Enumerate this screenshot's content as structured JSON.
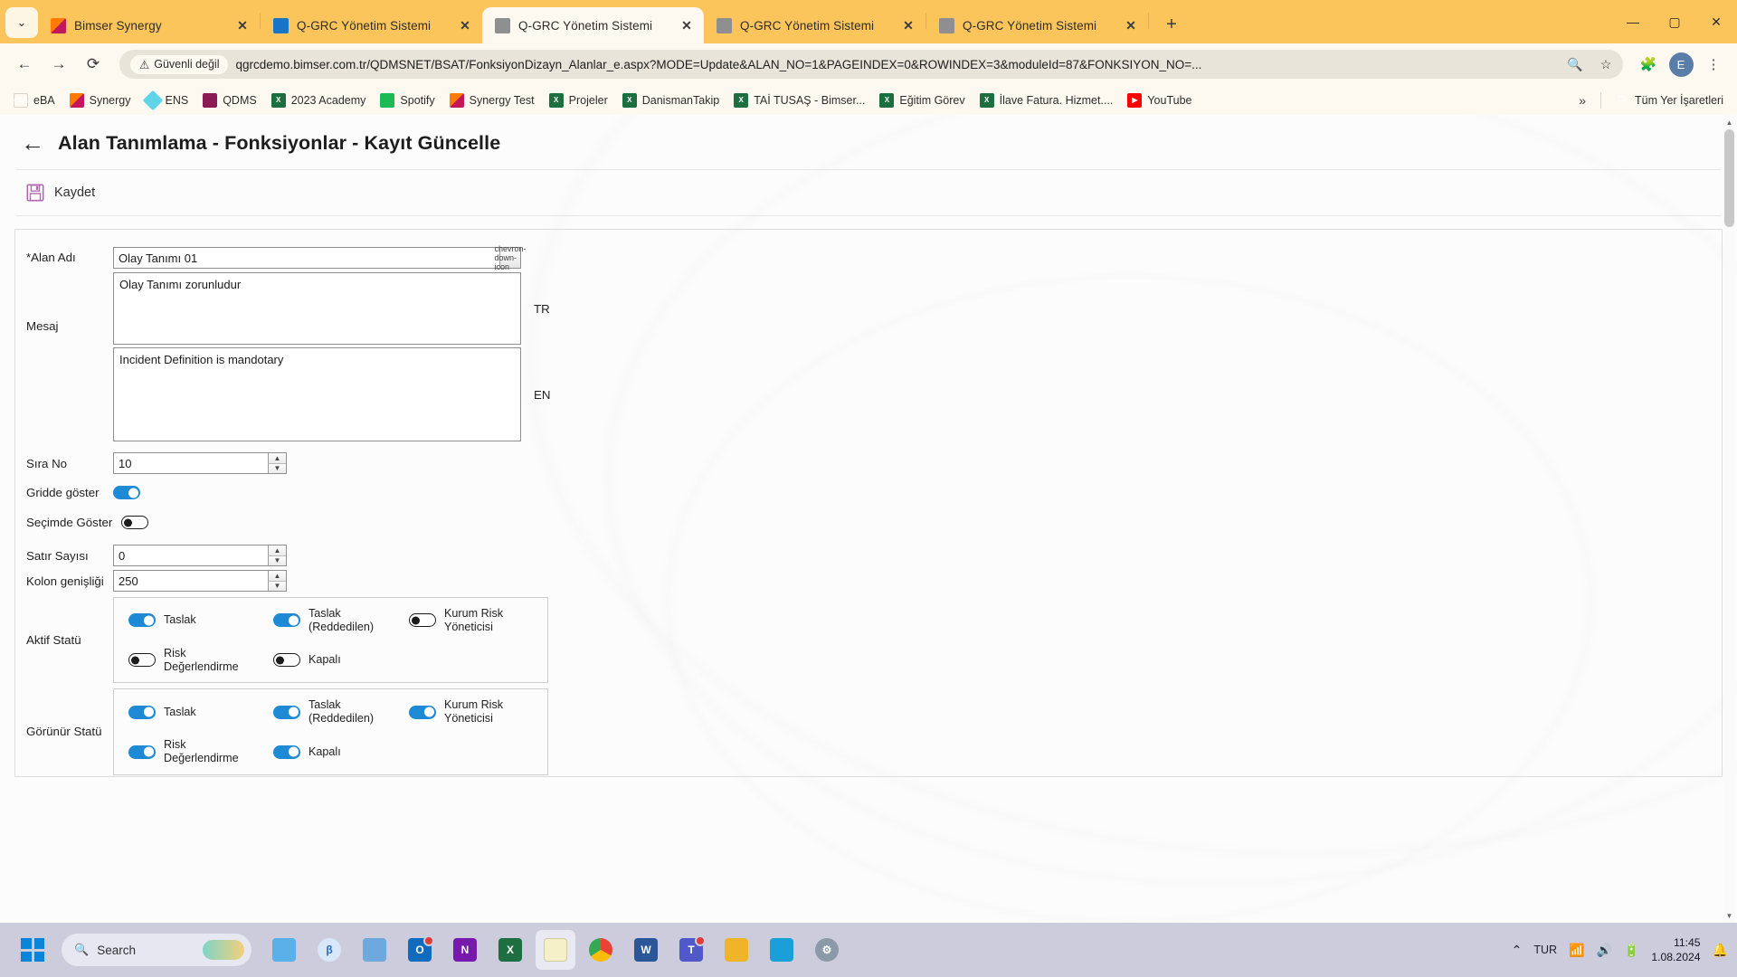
{
  "browser": {
    "tabs": [
      {
        "title": "Bimser Synergy",
        "favicon": "bimser-icon",
        "active": false
      },
      {
        "title": "Q-GRC Yönetim Sistemi",
        "favicon": "qgrc-icon",
        "active": false
      },
      {
        "title": "Q-GRC Yönetim Sistemi",
        "favicon": "globe-icon",
        "active": true
      },
      {
        "title": "Q-GRC Yönetim Sistemi",
        "favicon": "globe-icon",
        "active": false
      },
      {
        "title": "Q-GRC Yönetim Sistemi",
        "favicon": "globe-icon",
        "active": false
      }
    ],
    "tab_close_label": "✕",
    "new_tab_label": "+",
    "window_controls": {
      "minimize": "—",
      "maximize": "▢",
      "close": "✕"
    },
    "nav": {
      "back": "←",
      "forward": "→",
      "reload": "⟳"
    },
    "security_label": "Güvenli değil",
    "security_icon": "warning-triangle-icon",
    "url": "qgrcdemo.bimser.com.tr/QDMSNET/BSAT/FonksiyonDizayn_Alanlar_e.aspx?MODE=Update&ALAN_NO=1&PAGEINDEX=0&ROWINDEX=3&moduleId=87&FONKSIYON_NO=...",
    "zoom_icon": "zoom-search-icon",
    "bookmark_star": "☆",
    "extensions_icon": "extensions-icon",
    "profile_initial": "E",
    "menu_icon": "⋮"
  },
  "bookmarks": {
    "items": [
      {
        "label": "eBA",
        "icon": "eba-icon"
      },
      {
        "label": "Synergy",
        "icon": "synergy-icon"
      },
      {
        "label": "ENS",
        "icon": "ens-icon"
      },
      {
        "label": "QDMS",
        "icon": "qdms-icon"
      },
      {
        "label": "2023 Academy",
        "icon": "excel-icon"
      },
      {
        "label": "Spotify",
        "icon": "spotify-icon"
      },
      {
        "label": "Synergy Test",
        "icon": "synergy-icon"
      },
      {
        "label": "Projeler",
        "icon": "excel-icon"
      },
      {
        "label": "DanismanTakip",
        "icon": "excel-icon"
      },
      {
        "label": "TAİ TUSAŞ - Bimser...",
        "icon": "excel-icon"
      },
      {
        "label": "Eğitim Görev",
        "icon": "excel-icon"
      },
      {
        "label": "İlave Fatura. Hizmet....",
        "icon": "excel-icon"
      },
      {
        "label": "YouTube",
        "icon": "youtube-icon"
      }
    ],
    "overflow_label": "»",
    "all_bookmarks_label": "Tüm Yer İşaretleri",
    "all_bookmarks_icon": "folder-icon"
  },
  "app": {
    "back_arrow": "←",
    "title": "Alan Tanımlama - Fonksiyonlar - Kayıt Güncelle",
    "toolbar": {
      "save_label": "Kaydet",
      "save_icon": "save-floppy-icon"
    },
    "form": {
      "field_name": {
        "label": "*Alan Adı",
        "value": "Olay Tanımı  01",
        "dropdown_icon": "chevron-down-icon"
      },
      "message": {
        "label": "Mesaj",
        "tr_value": "Olay Tanımı zorunludur",
        "tr_tag": "TR",
        "en_value": "Incident Definition is mandotary",
        "en_tag": "EN"
      },
      "order_no": {
        "label": "Sıra No",
        "value": "10"
      },
      "show_in_grid": {
        "label": "Gridde göster",
        "state": "on"
      },
      "show_in_selection": {
        "label": "Seçimde Göster",
        "state": "off"
      },
      "row_count": {
        "label": "Satır Sayısı",
        "value": "0"
      },
      "column_width": {
        "label": "Kolon genişliği",
        "value": "250"
      },
      "active_status": {
        "label": "Aktif Statü",
        "items": [
          {
            "label": "Taslak",
            "state": "on"
          },
          {
            "label": "Taslak (Reddedilen)",
            "state": "on"
          },
          {
            "label": "Kurum Risk Yöneticisi",
            "state": "off"
          },
          {
            "label": "Risk Değerlendirme",
            "state": "off"
          },
          {
            "label": "Kapalı",
            "state": "off"
          }
        ]
      },
      "visible_status": {
        "label": "Görünür Statü",
        "items": [
          {
            "label": "Taslak",
            "state": "on"
          },
          {
            "label": "Taslak (Reddedilen)",
            "state": "on"
          },
          {
            "label": "Kurum Risk Yöneticisi",
            "state": "on"
          },
          {
            "label": "Risk Değerlendirme",
            "state": "on"
          },
          {
            "label": "Kapalı",
            "state": "on"
          }
        ]
      }
    }
  },
  "taskbar": {
    "start_icon": "windows-start-icon",
    "search_placeholder": "Search",
    "search_icon": "search-icon",
    "apps": [
      {
        "name": "paint-3d-icon"
      },
      {
        "name": "chrome-beta-icon"
      },
      {
        "name": "widgets-icon"
      },
      {
        "name": "outlook-icon"
      },
      {
        "name": "onenote-icon"
      },
      {
        "name": "excel-icon"
      },
      {
        "name": "sticky-notes-icon"
      },
      {
        "name": "chrome-icon"
      },
      {
        "name": "word-icon"
      },
      {
        "name": "teams-icon"
      },
      {
        "name": "file-explorer-icon"
      },
      {
        "name": "store-icon"
      },
      {
        "name": "settings-icon"
      }
    ],
    "tray": {
      "chevron_up": "⌃",
      "language": "TUR",
      "wifi_icon": "wifi-icon",
      "volume_icon": "volume-icon",
      "battery_icon": "battery-icon",
      "time": "11:45",
      "date": "1.08.2024",
      "notification_icon": "bell-icon"
    }
  },
  "colors": {
    "browser_accent": "#fcc55c",
    "toggle_on": "#1e8ad6",
    "taskbar": "#ccccdd"
  }
}
